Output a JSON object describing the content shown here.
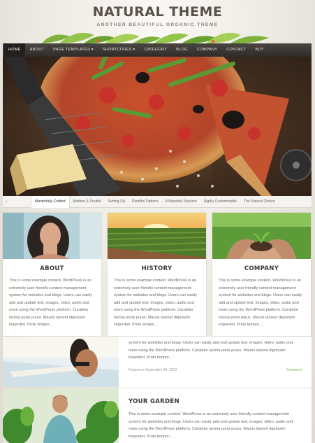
{
  "header": {
    "title": "NATURAL THEME",
    "tagline": "ANOTHER BEAUTIFUL ORGANIC THEME"
  },
  "nav": {
    "items": [
      {
        "label": "HOME"
      },
      {
        "label": "ABOUT"
      },
      {
        "label": "PAGE TEMPLATES ▾"
      },
      {
        "label": "SHORTCODES ▾"
      },
      {
        "label": "CATEGORY"
      },
      {
        "label": "BLOG"
      },
      {
        "label": "COMPANY"
      },
      {
        "label": "CONTACT"
      },
      {
        "label": "BUY"
      }
    ]
  },
  "slider": {
    "prev_icon": "‹",
    "tabs": [
      {
        "label": "Masterfully Crafted"
      },
      {
        "label": "Modern & Soulful"
      },
      {
        "label": "Surfing Fiji"
      },
      {
        "label": "Plentiful Options"
      },
      {
        "label": "A Beautiful Solution"
      },
      {
        "label": "Highly Customizable"
      },
      {
        "label": "The Natural Choice"
      }
    ]
  },
  "cards": [
    {
      "title": "ABOUT",
      "text": "This is some example content. WordPress is an extremely user friendly content management system for websites and blogs. Users can easily add and update text, images, video, audio and more using the WordPress platform. Curabitur lacinia porta purus. Mauris laoreet dignissim imperdiet. Proin tempor..."
    },
    {
      "title": "HISTORY",
      "text": "This is some example content. WordPress is an extremely user friendly content management system for websites and blogs. Users can easily add and update text, images, video, audio and more using the WordPress platform. Curabitur lacinia porta purus. Mauris laoreet dignissim imperdiet. Proin tempor..."
    },
    {
      "title": "COMPANY",
      "text": "This is some example content. WordPress is an extremely user friendly content management system for websites and blogs. Users can easily add and update text, images, video, audio and more using the WordPress platform. Curabitur lacinia porta purus. Mauris laoreet dignissim imperdiet. Proin tempor..."
    }
  ],
  "posts": [
    {
      "text": "system for websites and blogs. Users can easily add and update text, images, video, audio and more using the WordPress platform. Curabitur lacinia porta purus. Mauris laoreet dignissim imperdiet. Proin tempor...",
      "meta": "Posted on September 19, 2013",
      "comment": "Comment"
    },
    {
      "title": "YOUR GARDEN",
      "text": "This is some example content. WordPress is an extremely user friendly content management system for websites and blogs. Users can easily add and update text, images, video, audio and more using the WordPress platform. Curabitur lacinia porta purus. Mauris laoreet dignissim imperdiet. Proin tempor..."
    }
  ],
  "colors": {
    "accent": "#8ab24a",
    "nav_bg": "#2f2c29",
    "title": "#5a5148"
  }
}
